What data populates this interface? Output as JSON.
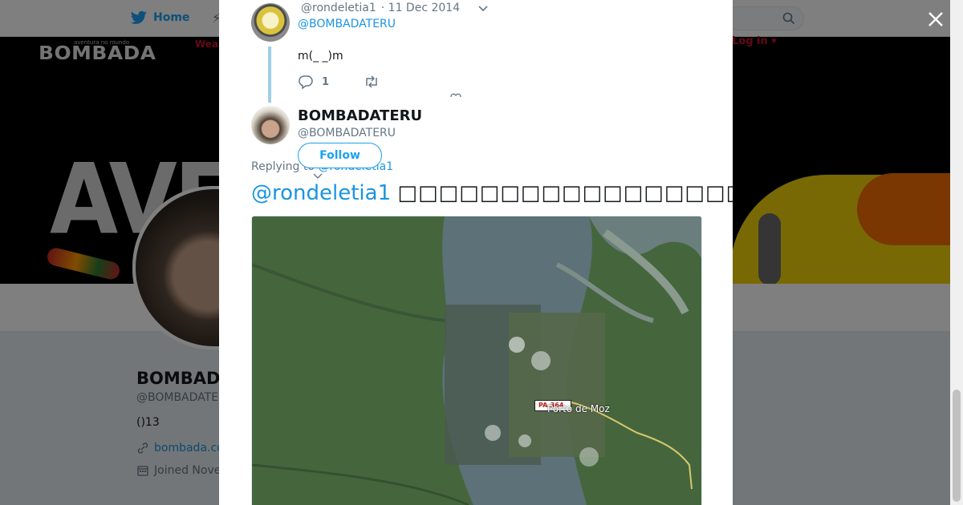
{
  "nav": {
    "home_label": "Home",
    "login_label": "Log in ▾"
  },
  "banner": {
    "logo_small": "aventura no mundo",
    "logo": "BOMBADA",
    "red_text": "Wear",
    "big_text": "AVEN"
  },
  "profile": {
    "name": "BOMBAD",
    "handle": "@BOMBADATE",
    "bio": "()13",
    "link": "bombada.co",
    "joined": "Joined Nove"
  },
  "parent_tweet": {
    "handle": "@rondeletia1",
    "date": "· 11 Dec 2014",
    "reply_to": "@BOMBADATERU",
    "text": "m(_ _)m",
    "reply_count": "1"
  },
  "main_tweet": {
    "name": "BOMBADATERU",
    "handle": "@BOMBADATERU",
    "follow_label": "Follow",
    "replying_prefix": "Replying to ",
    "replying_handle": "@rondeletia1",
    "mention": "@rondeletia1",
    "body": "□□□□□□□□□□□□□□□□□□□□□□□□□□□□□□□□□□□□□□□□□□□□",
    "map_place": "Porto de Moz",
    "map_badge": "PA-364"
  },
  "colors": {
    "accent": "#1da1f2",
    "link": "#1b95e0",
    "thread_line": "#9fcfe6",
    "banner_bg": "#000000"
  },
  "icons": {
    "nav_home": "twitter-bird-icon",
    "search": "search-icon",
    "close": "close-icon",
    "reply": "reply-icon",
    "retweet": "retweet-icon",
    "link": "link-icon",
    "calendar": "calendar-icon",
    "caret": "chevron-down-icon"
  }
}
